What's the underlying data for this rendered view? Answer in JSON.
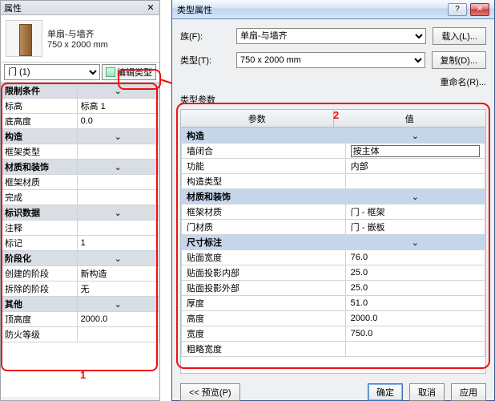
{
  "props_panel": {
    "title": "属性",
    "type_name": "单扇-与墙齐",
    "type_size": "750 x 2000 mm",
    "selector": "门 (1)",
    "edit_type_btn": "编辑类型",
    "sections": {
      "constraints": {
        "label": "限制条件",
        "rows": [
          {
            "name": "标高",
            "value": "标高 1"
          },
          {
            "name": "底高度",
            "value": "0.0"
          }
        ]
      },
      "construction": {
        "label": "构造",
        "rows": [
          {
            "name": "框架类型",
            "value": ""
          }
        ]
      },
      "materials": {
        "label": "材质和装饰",
        "rows": [
          {
            "name": "框架材质",
            "value": ""
          },
          {
            "name": "完成",
            "value": ""
          }
        ]
      },
      "identity": {
        "label": "标识数据",
        "rows": [
          {
            "name": "注释",
            "value": ""
          },
          {
            "name": "标记",
            "value": "1"
          }
        ]
      },
      "phasing": {
        "label": "阶段化",
        "rows": [
          {
            "name": "创建的阶段",
            "value": "新构造"
          },
          {
            "name": "拆除的阶段",
            "value": "无"
          }
        ]
      },
      "other": {
        "label": "其他",
        "rows": [
          {
            "name": "顶高度",
            "value": "2000.0"
          },
          {
            "name": "防火等级",
            "value": ""
          }
        ]
      }
    },
    "annotation": "1"
  },
  "dialog": {
    "title": "类型属性",
    "family_label": "族(F):",
    "family_value": "单扇-与墙齐",
    "type_label": "类型(T):",
    "type_value": "750 x 2000 mm",
    "load_btn": "载入(L)...",
    "duplicate_btn": "复制(D)...",
    "rename_btn": "重命名(R)...",
    "params_label": "类型参数",
    "header_param": "参数",
    "header_value": "值",
    "annotation": "2",
    "sections": {
      "construction": {
        "label": "构造",
        "rows": [
          {
            "name": "墙闭合",
            "value": "按主体",
            "editing": true
          },
          {
            "name": "功能",
            "value": "内部"
          },
          {
            "name": "构造类型",
            "value": ""
          }
        ]
      },
      "materials": {
        "label": "材质和装饰",
        "rows": [
          {
            "name": "框架材质",
            "value": "门 - 框架"
          },
          {
            "name": "门材质",
            "value": "门 - 嵌板"
          }
        ]
      },
      "dimensions": {
        "label": "尺寸标注",
        "rows": [
          {
            "name": "贴面宽度",
            "value": "76.0"
          },
          {
            "name": "贴面投影内部",
            "value": "25.0"
          },
          {
            "name": "贴面投影外部",
            "value": "25.0"
          },
          {
            "name": "厚度",
            "value": "51.0"
          },
          {
            "name": "高度",
            "value": "2000.0"
          },
          {
            "name": "宽度",
            "value": "750.0"
          },
          {
            "name": "粗略宽度",
            "value": ""
          }
        ]
      }
    },
    "footer": {
      "preview": "<< 预览(P)",
      "ok": "确定",
      "cancel": "取消",
      "apply": "应用"
    }
  }
}
